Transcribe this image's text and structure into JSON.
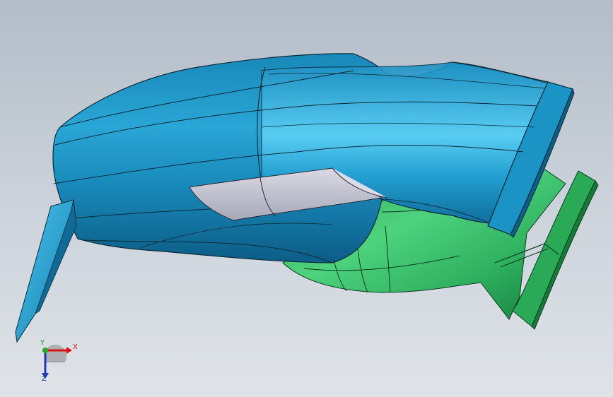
{
  "viewport": {
    "background_top": "#b3bcc8",
    "background_bottom": "#dfe3e8"
  },
  "model": {
    "body_color": "#1e9fcf",
    "body_dark": "#0d5f86",
    "secondary_color": "#2fb65e",
    "secondary_dark": "#167a3a",
    "insert_color": "#c2c3d1",
    "edge_color": "#0b2a38"
  },
  "triad": {
    "x_label": "X",
    "y_label": "Y",
    "z_label": "Z",
    "x_color": "#dd1111",
    "y_color": "#22aa22",
    "z_color": "#2233bb",
    "icon": "coordinate-triad-icon"
  }
}
